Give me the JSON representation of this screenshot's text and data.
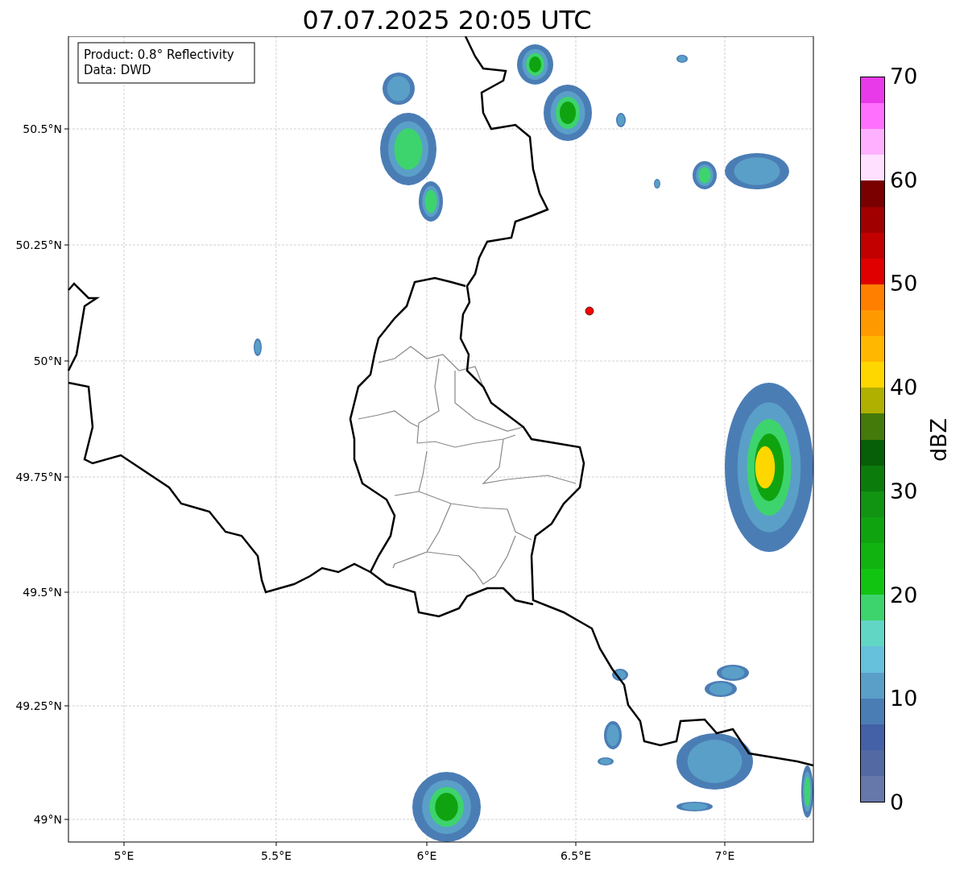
{
  "title": "07.07.2025 20:05 UTC",
  "info_box": [
    "Product: 0.8° Reflectivity",
    "Data: DWD"
  ],
  "map": {
    "x_ticks": [
      "5°E",
      "5.5°E",
      "6°E",
      "6.5°E",
      "7°E"
    ],
    "y_ticks": [
      "50.5°N",
      "50.25°N",
      "50°N",
      "49.75°N",
      "49.5°N",
      "49.25°N",
      "49°N"
    ]
  },
  "colorbar": {
    "label": "dBZ",
    "ticks": [
      "70",
      "60",
      "50",
      "40",
      "30",
      "20",
      "10",
      "0"
    ],
    "segments": [
      {
        "color": "#6677aa"
      },
      {
        "color": "#5269a3"
      },
      {
        "color": "#4460a6"
      },
      {
        "color": "#4b7db5"
      },
      {
        "color": "#5a9fc8"
      },
      {
        "color": "#66c1dc"
      },
      {
        "color": "#62d6c5"
      },
      {
        "color": "#3dd46d"
      },
      {
        "color": "#12c412"
      },
      {
        "color": "#11b311"
      },
      {
        "color": "#10a310"
      },
      {
        "color": "#119411"
      },
      {
        "color": "#0b7c0b"
      },
      {
        "color": "#075f07"
      },
      {
        "color": "#447a0a"
      },
      {
        "color": "#b0b000"
      },
      {
        "color": "#ffd700"
      },
      {
        "color": "#ffb700"
      },
      {
        "color": "#ff9900"
      },
      {
        "color": "#ff7f00"
      },
      {
        "color": "#e00000"
      },
      {
        "color": "#c20000"
      },
      {
        "color": "#a10000"
      },
      {
        "color": "#7a0000"
      },
      {
        "color": "#ffe0ff"
      },
      {
        "color": "#ffb0ff"
      },
      {
        "color": "#ff70ff"
      },
      {
        "color": "#e83ae8"
      }
    ]
  }
}
